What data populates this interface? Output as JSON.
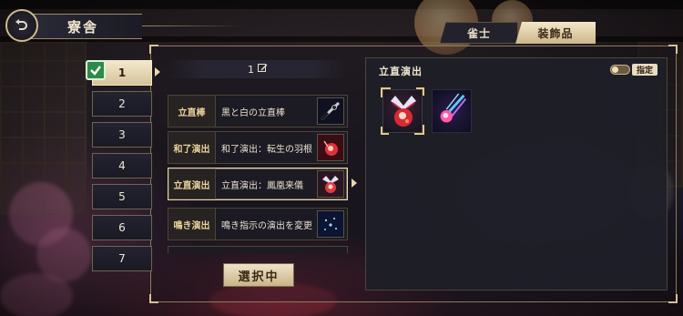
{
  "header": {
    "title": "寮舎"
  },
  "tabs": [
    {
      "label": "雀士",
      "active": false
    },
    {
      "label": "装飾品",
      "active": true
    }
  ],
  "presets": [
    {
      "label": "1",
      "active": true
    },
    {
      "label": "2"
    },
    {
      "label": "3"
    },
    {
      "label": "4"
    },
    {
      "label": "5"
    },
    {
      "label": "6"
    },
    {
      "label": "7"
    }
  ],
  "preset_name": "1",
  "items": [
    {
      "category": "立直棒",
      "name": "黒と白の立直棒"
    },
    {
      "category": "和了演出",
      "name": "和了演出：転生の羽根"
    },
    {
      "category": "立直演出",
      "name": "立直演出：鳳凰来儀",
      "selected": true
    },
    {
      "category": "鳴き演出",
      "name": "鳴き指示の演出を変更"
    }
  ],
  "select_button": "選択中",
  "panel": {
    "title": "立直演出",
    "toggle_label": "指定",
    "toggle_on": true
  },
  "colors": {
    "accent": "#e9d7ab",
    "check_green": "#2e8a4a"
  }
}
